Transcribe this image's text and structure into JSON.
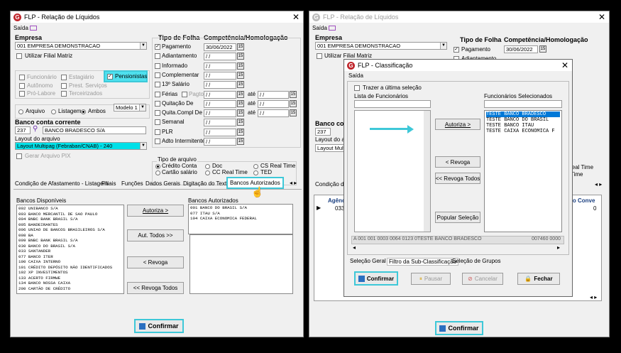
{
  "left": {
    "title": "FLP - Relação de Líquidos",
    "menu": "Saída",
    "empresa_label": "Empresa",
    "empresa_value": "001 EMPRESA DEMONSTRACAO",
    "filial_label": "Utilizar Filial Matriz",
    "tipos": {
      "funcionario": "Funcionário",
      "estagiario": "Estagiário",
      "pensionistas": "Pensionistas",
      "autonomo": "Autônomo",
      "prest": "Prest. Serviços",
      "prolabore": "Pró-Labore",
      "terceirizados": "Terceirizados"
    },
    "saida": {
      "arquivo": "Arquivo",
      "listagem": "Listagem",
      "ambos": "Ambos",
      "modelo": "Modelo 1"
    },
    "banco_label": "Banco conta corrente",
    "banco_code": "237",
    "banco_name": "BANCO BRADESCO S/A",
    "layout_label": "Layout do arquivo",
    "layout_value": "Layout Multipag (Febraban/CNAB) - 240",
    "pix_label": "Gerar Arquivo PIX",
    "tipo_folha_label": "Tipo de Folha",
    "competencia_label": "Competência/Homologação",
    "folha": [
      {
        "label": "Pagamento",
        "date": "30/06/2022",
        "checked": true
      },
      {
        "label": "Adiantamento",
        "date": "/ /",
        "checked": false
      },
      {
        "label": "Informado",
        "date": "/ /",
        "checked": false
      },
      {
        "label": "Complementar",
        "date": "/ /",
        "checked": false
      },
      {
        "label": "13º Salário",
        "date": "/ /",
        "checked": false
      },
      {
        "label": "Férias",
        "date": "/ /",
        "checked": false
      },
      {
        "label": "Quitação De",
        "date": "/ /",
        "checked": false
      },
      {
        "label": "Quita.Compl De",
        "date": "/ /",
        "checked": false
      },
      {
        "label": "Semanal",
        "date": "/ /",
        "checked": false
      },
      {
        "label": "PLR",
        "date": "/ /",
        "checked": false
      },
      {
        "label": "Adto Intermitente",
        "date": "/ /",
        "checked": false
      }
    ],
    "pagto": "Pagto",
    "ate": "até",
    "range_date": "/ /",
    "tipo_arquivo_label": "Tipo de arquivo",
    "tipo_arquivo": {
      "credito": "Crédito Conta",
      "doc": "Doc",
      "cs": "CS Real Time",
      "cartao": "Cartão salário",
      "cc": "CC Real Time",
      "ted": "TED"
    },
    "tabs": [
      "Condição de Afastamento - Listagem",
      "Filiais",
      "Funções",
      "Dados Gerais",
      "Digitação do Texto",
      "Bancos Autorizados"
    ],
    "disp_label": "Bancos Disponíveis",
    "aut_label": "Bancos Autorizados",
    "disponiveis": [
      "002 UNIBANCO S/A",
      "003 BANCO MERCANTIL DE SAO PAULO",
      "004 BNBC BANK BRASIL S/A",
      "005 BANDEIRANTES",
      "006 UNIAO DE BANCOS BRASILEIROS S/A",
      "008 BA",
      "009 BNBC BANK BRASIL S/A",
      "030 BANCO DO BRASIL S/A",
      "033 SANTANDER",
      "077 BANCO ITER",
      "100 CAIXA INTERNO",
      "101 CRÉDITO DEPÓSITO NÃO IDENTIFICADOS",
      "102 XP INVESTIMENTOS",
      "133 ACERTO FIRMWE",
      "134 BANCO NOSSA CAIXA",
      "200 CARTÃO DE CRÉDITO"
    ],
    "autorizados": [
      "001 BANCO DO BRASIL S/A",
      "077 ITAU S/A",
      "104 CAIXA ECONOMICA FEDERAL"
    ],
    "btn_autoriza": "Autoriza >",
    "btn_aut_todos": "Aut. Todos >>",
    "btn_revoga": "< Revoga",
    "btn_revoga_todos": "<< Revoga Todos",
    "confirmar": "Confirmar"
  },
  "right": {
    "title": "FLP - Relação de Líquidos",
    "menu": "Saída",
    "empresa_label": "Empresa",
    "empresa_value": "001 EMPRESA DEMONSTRACAO",
    "filial_label": "Utilizar Filial Matriz",
    "tipo_folha_label": "Tipo de Folha",
    "competencia_label": "Competência/Homologação",
    "pagamento": "Pagamento",
    "pagamento_date": "30/06/2022",
    "adiantamento": "Adiantamento",
    "banco_label": "Banco conta",
    "banco_code": "237",
    "layout_label": "Layout do arqu",
    "layout_value": "Layout Multip",
    "cond_tab": "Condição de A",
    "grid_col1": "Agênc",
    "grid_cell1": "0337",
    "grid_col2": "do Conve",
    "grid_cell2": "0",
    "realtime": "Real Time",
    "time": "Time",
    "confirmar": "Confirmar"
  },
  "dialog": {
    "title": "FLP - Classificação",
    "menu": "Saída",
    "trazer": "Trazer a última seleção",
    "lista_label": "Lista de Funcionários",
    "sel_label": "Funcionários Selecionados",
    "selecionados": [
      "TESTE BANCO BRADESCO",
      "TESTE BANCO DO BRASIL",
      "TESTE BANCO ITAU",
      "TESTE CAIXA ECONOMICA F"
    ],
    "btn_autoriza": "Autoriza >",
    "btn_revoga": "< Revoga",
    "btn_revoga_todos": "<< Revoga Todos",
    "btn_popular": "Popular Seleção",
    "status_left": "A 001 001 0003 0064 0123 0TESTE BANCO BRADESCO",
    "status_right": "007460 0000",
    "tabs": [
      "Seleção Geral",
      "Filtro da Sub-Classificação",
      "Seleção de Grupos"
    ],
    "confirmar": "Confirmar",
    "pausar": "Pausar",
    "cancelar": "Cancelar",
    "fechar": "Fechar"
  },
  "colors": {
    "highlight": "#3ec8d8",
    "arrow": "#3ec8d8",
    "selected": "#0078d7",
    "layout_bg": "#00e0e8",
    "logo": "#c0262c"
  }
}
